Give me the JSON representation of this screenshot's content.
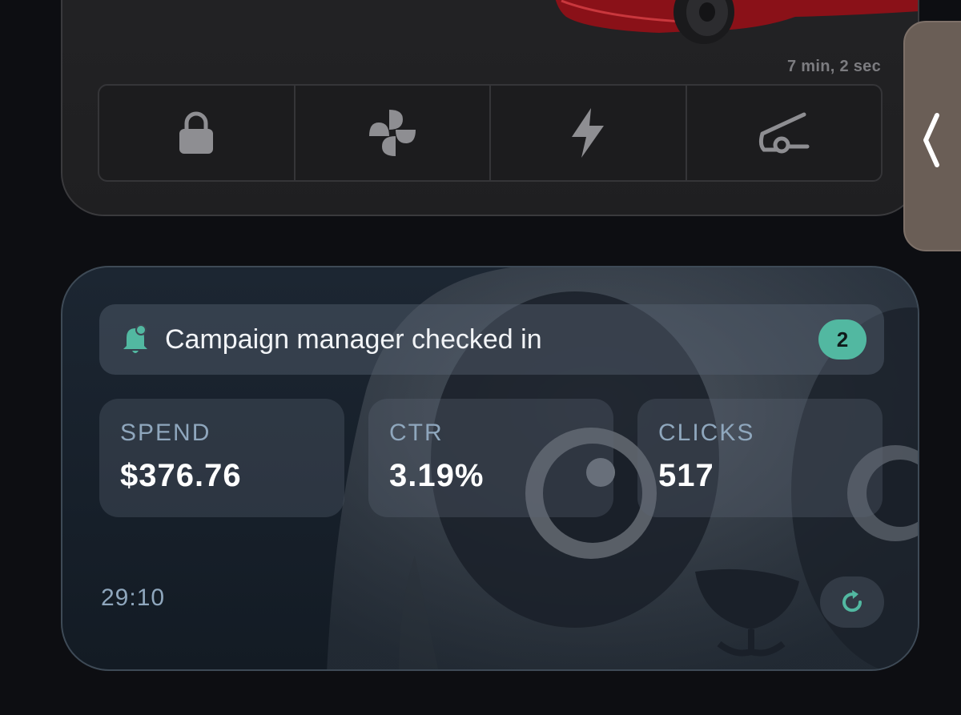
{
  "car": {
    "elapsed": "7 min, 2 sec",
    "controls": [
      {
        "name": "lock",
        "icon": "lock-icon"
      },
      {
        "name": "climate",
        "icon": "fan-icon"
      },
      {
        "name": "charge",
        "icon": "lightning-icon"
      },
      {
        "name": "frunk",
        "icon": "frunk-icon"
      }
    ]
  },
  "side_panel": {
    "icon": "chevron-left-icon"
  },
  "campaign": {
    "notification": {
      "icon": "bell-icon",
      "title": "Campaign manager checked in",
      "badge_count": "2"
    },
    "metrics": [
      {
        "label": "SPEND",
        "value": "$376.76"
      },
      {
        "label": "CTR",
        "value": "3.19%"
      },
      {
        "label": "CLICKS",
        "value": "517"
      }
    ],
    "timer": "29:10",
    "refresh_icon": "refresh-icon"
  },
  "colors": {
    "accent": "#52b8a1",
    "metric_label": "#8fa7bd",
    "car_body": "#8a1118"
  }
}
